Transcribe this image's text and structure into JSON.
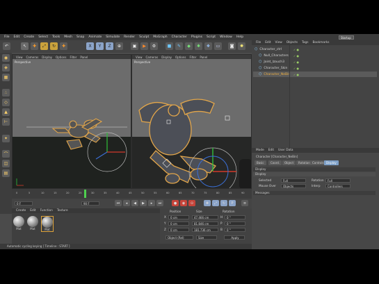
{
  "menu": [
    "File",
    "Edit",
    "Create",
    "Select",
    "Tools",
    "Mesh",
    "Snap",
    "Animate",
    "Simulate",
    "Render",
    "Sculpt",
    "MoGraph",
    "Character",
    "Plugins",
    "Script",
    "Window",
    "Help"
  ],
  "layout": {
    "label": "Layout:",
    "value": "Startup"
  },
  "toolbar_icons": [
    "undo-icon",
    "live-select-icon",
    "move-icon",
    "scale-icon",
    "rotate-icon",
    "recent-tool-icon",
    "x-axis-icon",
    "y-axis-icon",
    "z-axis-icon",
    "world-coord-icon",
    "render-view-icon",
    "render-picture-icon",
    "edit-render-settings-icon",
    "cube-icon",
    "pen-icon",
    "subdivision-icon",
    "array-icon",
    "deformer-icon",
    "floor-icon",
    "camera-icon",
    "light-icon"
  ],
  "viewports": [
    {
      "menus": [
        "View",
        "Cameras",
        "Display",
        "Options",
        "Filter",
        "Panel"
      ],
      "label": "Perspective"
    },
    {
      "menus": [
        "View",
        "Cameras",
        "Display",
        "Options",
        "Filter",
        "Panel"
      ],
      "label": "Perspective"
    }
  ],
  "timeline": {
    "ticks": [
      "0",
      "5",
      "10",
      "15",
      "20",
      "25",
      "30",
      "35",
      "40",
      "45",
      "50",
      "55",
      "60",
      "65",
      "70",
      "75",
      "80",
      "85",
      "90"
    ],
    "current_frame": "0 F"
  },
  "playback": {
    "start": "0 F",
    "end": "90 F"
  },
  "materials": {
    "menus": [
      "Create",
      "Edit",
      "Function",
      "Texture"
    ],
    "names": [
      "Mat",
      "Mat",
      "Mat"
    ]
  },
  "coordinates": {
    "headers": [
      "Position",
      "Size",
      "Rotation"
    ],
    "rows": [
      {
        "axis": "X",
        "pos": "0 cm",
        "size": "47.466 cm",
        "rotaxis": "H",
        "rot": "0 °"
      },
      {
        "axis": "Y",
        "pos": "0 cm",
        "size": "81.846 cm",
        "rotaxis": "P",
        "rot": "0 °"
      },
      {
        "axis": "Z",
        "pos": "0 cm",
        "size": "181.736 cm",
        "rotaxis": "B",
        "rot": "0 °"
      }
    ],
    "mode": "Object (Rel)",
    "size_mode": "Size",
    "apply": "Apply"
  },
  "objects": {
    "menus": [
      "File",
      "Edit",
      "View",
      "Objects",
      "Tags",
      "Bookmarks"
    ],
    "items": [
      {
        "name": "Character_ctrl",
        "selected": false
      },
      {
        "name": "Null_Characters",
        "selected": false
      },
      {
        "name": "Joint_lzauch3",
        "selected": false
      },
      {
        "name": "Character_Skin",
        "selected": false
      },
      {
        "name": "Character_NeBin",
        "selected": true
      }
    ]
  },
  "attributes": {
    "menus": [
      "Mode",
      "Edit",
      "User Data"
    ],
    "object_line": "Character [Character_NeBin]",
    "tabs": [
      {
        "label": "Basic",
        "active": false
      },
      {
        "label": "Coord.",
        "active": false
      },
      {
        "label": "Object",
        "active": false
      },
      {
        "label": "Rotation",
        "active": false
      },
      {
        "label": "Controls",
        "active": false
      },
      {
        "label": "Display",
        "active": true
      }
    ],
    "section": "Display",
    "subsection": "Display",
    "fields": [
      {
        "label": "Selected",
        "value": "Full",
        "label2": "Rotation",
        "value2": "Full"
      },
      {
        "label": "Mouse Over",
        "value": "Objects",
        "label2": "Interp",
        "value2": "Controllers"
      }
    ],
    "section2": "Messages"
  },
  "status": "Automatic cycling keying [ Timeline : START ]",
  "colors": {
    "accent": "#7d9fc7",
    "gizmo_red": "#d23a2a",
    "gizmo_green": "#2fbf3a",
    "gizmo_blue": "#3b6fd6",
    "highlight": "#e3a64a"
  }
}
